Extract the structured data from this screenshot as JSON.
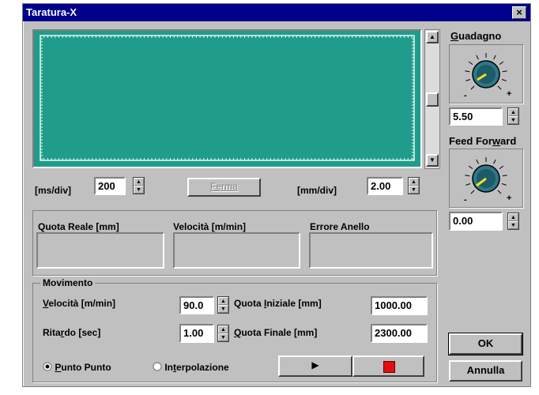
{
  "window": {
    "title": "Taratura-X",
    "close_glyph": "×"
  },
  "scope": {
    "ms_div_label": "[ms/div]",
    "ms_div_value": "200",
    "stop_button": "Ferma",
    "mm_div_label": "[mm/div]",
    "mm_div_value": "2.00",
    "screen_color": "#1f9c8c"
  },
  "readouts": {
    "quota_reale": "Quota Reale [mm]",
    "velocita": "Velocità [m/min]",
    "errore": "Errore Anello"
  },
  "movimento": {
    "title": "Movimento",
    "velocita_label_pre": "V",
    "velocita_label_post": "elocità [m/min]",
    "velocita_value": "90.0",
    "quota_iniziale_pre": "Quota ",
    "quota_iniziale_u": "I",
    "quota_iniziale_post": "niziale [mm]",
    "quota_iniziale_value": "1000.00",
    "ritardo_pre": "Rita",
    "ritardo_u": "r",
    "ritardo_post": "do [sec]",
    "ritardo_value": "1.00",
    "quota_finale_pre": "",
    "quota_finale_u": "Q",
    "quota_finale_post": "uota Finale [mm]",
    "quota_finale_value": "2300.00",
    "radio_punto_pre": "",
    "radio_punto_u": "P",
    "radio_punto_post": "unto Punto",
    "radio_interp_pre": "In",
    "radio_interp_u": "t",
    "radio_interp_post": "erpolazione",
    "play_glyph": "▶",
    "stop_color": "#e01010"
  },
  "guadagno": {
    "label_u": "G",
    "label_post": "uadagno",
    "value": "5.50",
    "minus": "-",
    "plus": "+"
  },
  "feed_forward": {
    "label_pre": "Feed For",
    "label_u": "w",
    "label_post": "ard",
    "value": "0.00",
    "minus": "-",
    "plus": "+"
  },
  "buttons": {
    "ok": "OK",
    "annulla": "Annulla"
  }
}
